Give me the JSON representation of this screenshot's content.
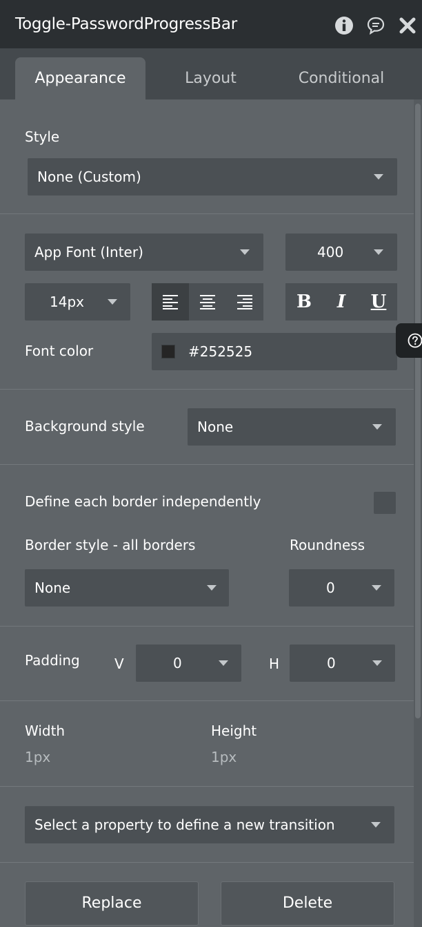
{
  "header": {
    "title": "Toggle-PasswordProgressBar",
    "icons": [
      "info-icon",
      "comment-icon",
      "close-icon"
    ]
  },
  "tabs": [
    {
      "label": "Appearance",
      "active": true
    },
    {
      "label": "Layout",
      "active": false
    },
    {
      "label": "Conditional",
      "active": false
    }
  ],
  "style": {
    "label": "Style",
    "value": "None (Custom)"
  },
  "font": {
    "family": "App Font (Inter)",
    "weight": "400",
    "size": "14px",
    "align_options": [
      "align-left-icon",
      "align-center-icon",
      "align-right-icon"
    ],
    "selected_align": "left",
    "bold": "B",
    "italic": "I",
    "underline": "U",
    "color_label": "Font color",
    "color_value": "#252525",
    "swatch": "#252525"
  },
  "background": {
    "label": "Background style",
    "value": "None"
  },
  "border": {
    "independent_label": "Define each border independently",
    "style_label": "Border style - all borders",
    "style_value": "None",
    "roundness_label": "Roundness",
    "roundness_value": "0"
  },
  "padding": {
    "label": "Padding",
    "v_label": "V",
    "v_value": "0",
    "h_label": "H",
    "h_value": "0"
  },
  "size": {
    "width_label": "Width",
    "width_value": "1px",
    "height_label": "Height",
    "height_value": "1px"
  },
  "transition": {
    "placeholder": "Select a property to define a new transition"
  },
  "actions": {
    "replace": "Replace",
    "delete": "Delete"
  },
  "colors": {
    "titlebar": "#2b2f32",
    "panel": "#5f6468",
    "field": "#4b5054"
  }
}
